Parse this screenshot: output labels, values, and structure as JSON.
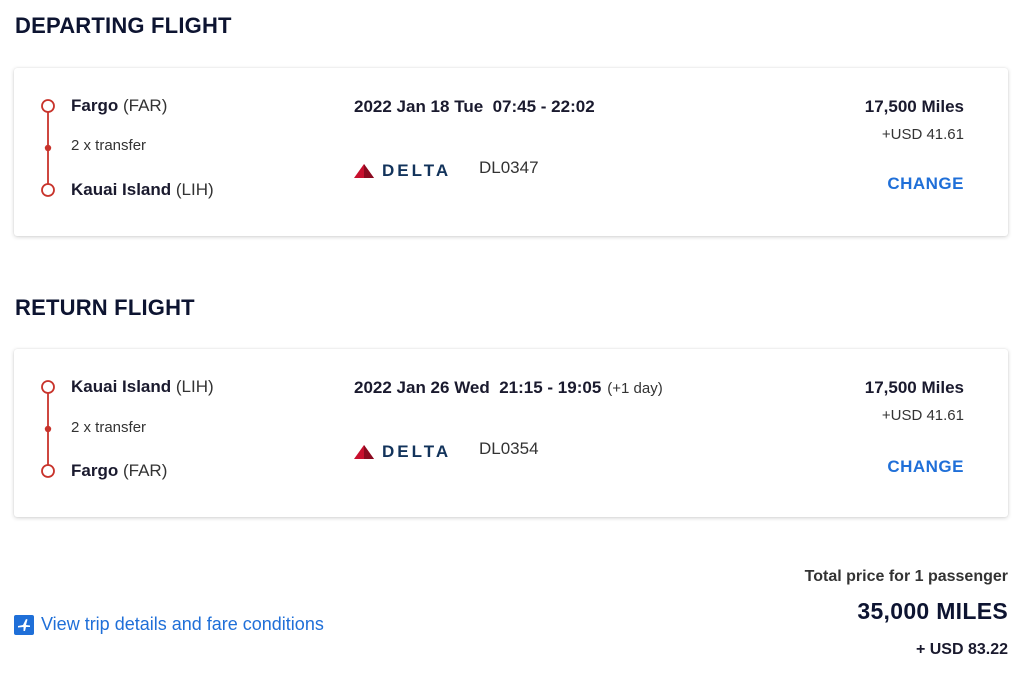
{
  "departing": {
    "section_title": "DEPARTING FLIGHT",
    "origin_city": "Fargo",
    "origin_code": "(FAR)",
    "transfer": "2 x transfer",
    "destination_city": "Kauai Island",
    "destination_code": "(LIH)",
    "datetime": "2022 Jan 18 Tue  07:45 - 22:02",
    "plus_day": "",
    "airline": "DELTA",
    "flight_no": "DL0347",
    "miles": "17,500 Miles",
    "usd": "+USD 41.61",
    "change_label": "CHANGE"
  },
  "return": {
    "section_title": "RETURN FLIGHT",
    "origin_city": "Kauai Island",
    "origin_code": "(LIH)",
    "transfer": "2 x transfer",
    "destination_city": "Fargo",
    "destination_code": "(FAR)",
    "datetime": "2022 Jan 26 Wed  21:15 - 19:05",
    "plus_day": "(+1 day)",
    "airline": "DELTA",
    "flight_no": "DL0354",
    "miles": "17,500 Miles",
    "usd": "+USD 41.61",
    "change_label": "CHANGE"
  },
  "footer": {
    "details_link": "View trip details and fare conditions",
    "total_label": "Total price for 1 passenger",
    "total_miles": "35,000 MILES",
    "total_usd": "+ USD 83.22"
  },
  "colors": {
    "accent": "#1f6fd8",
    "timeline": "#c8332b",
    "delta_red": "#c8102e",
    "delta_navy": "#12335b"
  },
  "icons": {
    "timeline_node": "circle-outline-icon",
    "delta_logo": "delta-widget-icon",
    "details": "plane-info-icon"
  }
}
